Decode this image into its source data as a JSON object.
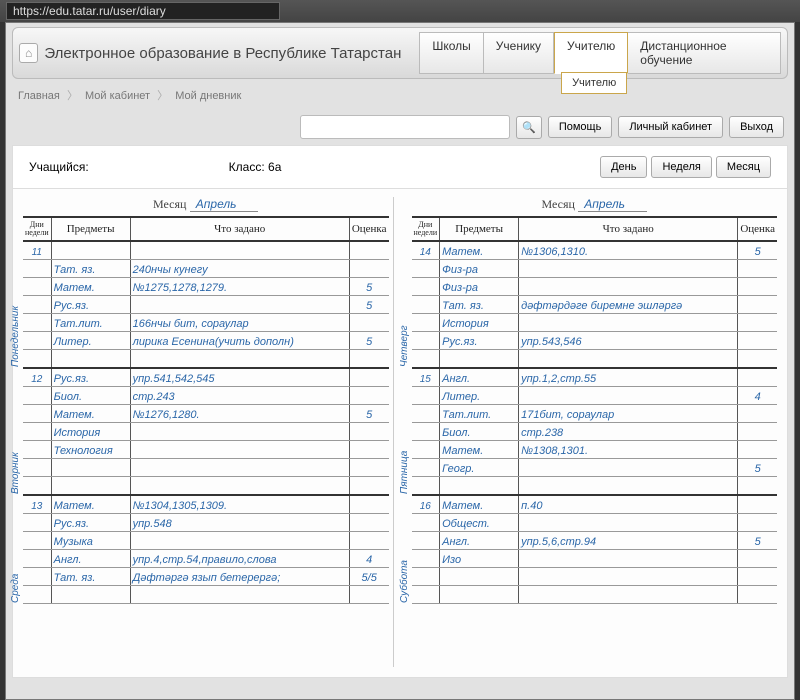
{
  "url": "https://edu.tatar.ru/user/diary",
  "site_title": "Электронное образование в Республике Татарстан",
  "top_tabs": [
    "Школы",
    "Ученику",
    "Учителю",
    "Дистанционное обучение"
  ],
  "active_tab_index": 2,
  "tab_dropdown": "Учителю",
  "breadcrumbs": [
    "Главная",
    "Мой кабинет",
    "Мой дневник"
  ],
  "search": {
    "placeholder": ""
  },
  "toolbar": {
    "help": "Помощь",
    "cabinet": "Личный кабинет",
    "logout": "Выход"
  },
  "info": {
    "student_label": "Учащийся:",
    "student": "",
    "class_label": "Класс:",
    "class_value": "6а"
  },
  "view_buttons": {
    "day": "День",
    "week": "Неделя",
    "month": "Месяц"
  },
  "month_label": "Месяц",
  "month_value": "Апрель",
  "headers": {
    "day": "Дни недели",
    "subject": "Предметы",
    "homework": "Что задано",
    "grade": "Оценка"
  },
  "left_days": [
    {
      "num": "11",
      "name": "Понедельник",
      "rows": [
        {
          "s": "",
          "h": "",
          "g": ""
        },
        {
          "s": "Тат. яз.",
          "h": "240нчы кунегу",
          "g": ""
        },
        {
          "s": "Матем.",
          "h": "№1275,1278,1279.",
          "g": "5"
        },
        {
          "s": "Рус.яз.",
          "h": "",
          "g": "5"
        },
        {
          "s": "Тат.лит.",
          "h": "166нчы бит, сораулар",
          "g": ""
        },
        {
          "s": "Литер.",
          "h": "лирика Есенина(учить дополн)",
          "g": "5"
        },
        {
          "s": "",
          "h": "",
          "g": ""
        }
      ]
    },
    {
      "num": "12",
      "name": "Вторник",
      "rows": [
        {
          "s": "Рус.яз.",
          "h": "упр.541,542,545",
          "g": ""
        },
        {
          "s": "Биол.",
          "h": "стр.243",
          "g": ""
        },
        {
          "s": "Матем.",
          "h": "№1276,1280.",
          "g": "5"
        },
        {
          "s": "История",
          "h": "",
          "g": ""
        },
        {
          "s": "Технология",
          "h": "",
          "g": ""
        },
        {
          "s": "",
          "h": "",
          "g": ""
        },
        {
          "s": "",
          "h": "",
          "g": ""
        }
      ]
    },
    {
      "num": "13",
      "name": "Среда",
      "rows": [
        {
          "s": "Матем.",
          "h": "№1304,1305,1309.",
          "g": ""
        },
        {
          "s": "Рус.яз.",
          "h": "упр.548",
          "g": ""
        },
        {
          "s": "Музыка",
          "h": "",
          "g": ""
        },
        {
          "s": "Англ.",
          "h": "упр.4,стр.54,правило,слова",
          "g": "4"
        },
        {
          "s": "Тат. яз.",
          "h": "Дәфтәргә язып бетерергә;",
          "g": "5/5"
        },
        {
          "s": "",
          "h": "",
          "g": ""
        }
      ]
    }
  ],
  "right_days": [
    {
      "num": "14",
      "name": "Четверг",
      "rows": [
        {
          "s": "Матем.",
          "h": "№1306,1310.",
          "g": "5"
        },
        {
          "s": "Физ-ра",
          "h": "",
          "g": ""
        },
        {
          "s": "Физ-ра",
          "h": "",
          "g": ""
        },
        {
          "s": "Тат. яз.",
          "h": "дәфтәрдәге биремне эшләргә",
          "g": ""
        },
        {
          "s": "История",
          "h": "",
          "g": ""
        },
        {
          "s": "Рус.яз.",
          "h": "упр.543,546",
          "g": ""
        },
        {
          "s": "",
          "h": "",
          "g": ""
        }
      ]
    },
    {
      "num": "15",
      "name": "Пятница",
      "rows": [
        {
          "s": "Англ.",
          "h": "упр.1,2,стр.55",
          "g": ""
        },
        {
          "s": "Литер.",
          "h": "",
          "g": "4"
        },
        {
          "s": "Тат.лит.",
          "h": "171бит, сораулар",
          "g": ""
        },
        {
          "s": "Биол.",
          "h": "стр.238",
          "g": ""
        },
        {
          "s": "Матем.",
          "h": "№1308,1301.",
          "g": ""
        },
        {
          "s": "Геогр.",
          "h": "",
          "g": "5"
        },
        {
          "s": "",
          "h": "",
          "g": ""
        }
      ]
    },
    {
      "num": "16",
      "name": "Суббота",
      "rows": [
        {
          "s": "Матем.",
          "h": "п.40",
          "g": ""
        },
        {
          "s": "Общест.",
          "h": "",
          "g": ""
        },
        {
          "s": "Англ.",
          "h": "упр.5,6,стр.94",
          "g": "5"
        },
        {
          "s": "Изо",
          "h": "",
          "g": ""
        },
        {
          "s": "",
          "h": "",
          "g": ""
        },
        {
          "s": "",
          "h": "",
          "g": ""
        }
      ]
    }
  ]
}
